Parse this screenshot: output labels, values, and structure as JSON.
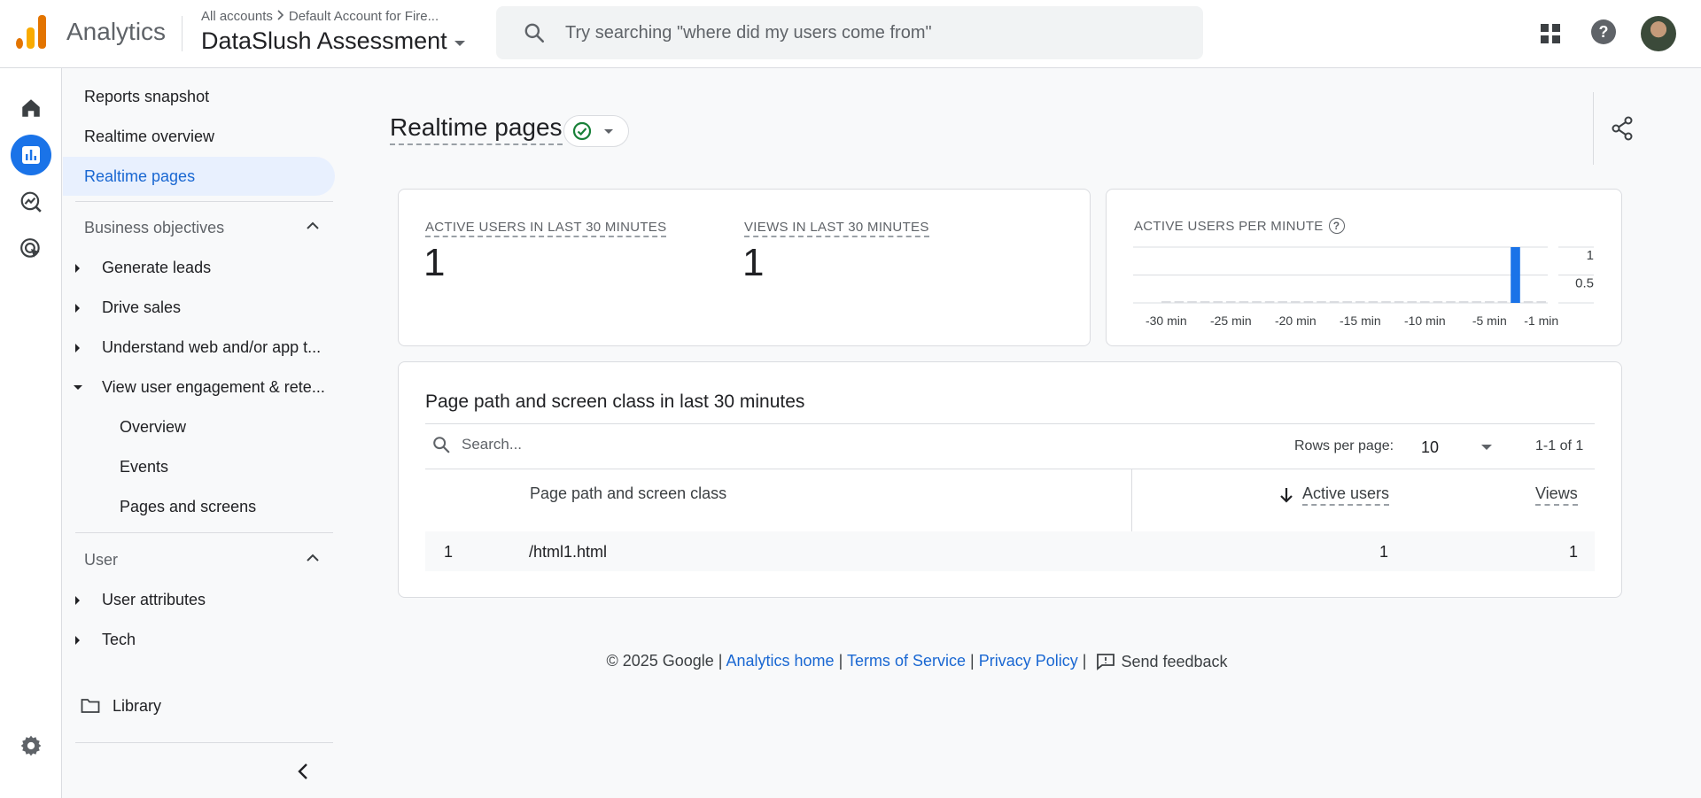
{
  "header": {
    "app_name": "Analytics",
    "breadcrumb_accounts": "All accounts",
    "breadcrumb_account": "Default Account for Fire...",
    "property_name": "DataSlush Assessment",
    "search_placeholder": "Try searching \"where did my users come from\""
  },
  "sidebar": {
    "items_top": [
      {
        "label": "Reports snapshot"
      },
      {
        "label": "Realtime overview"
      },
      {
        "label": "Realtime pages"
      }
    ],
    "business_objectives": {
      "title": "Business objectives",
      "items": [
        {
          "label": "Generate leads"
        },
        {
          "label": "Drive sales"
        },
        {
          "label": "Understand web and/or app t..."
        },
        {
          "label": "View user engagement & rete..."
        }
      ],
      "sub_items": [
        {
          "label": "Overview"
        },
        {
          "label": "Events"
        },
        {
          "label": "Pages and screens"
        }
      ]
    },
    "user_section": {
      "title": "User",
      "items": [
        {
          "label": "User attributes"
        },
        {
          "label": "Tech"
        }
      ]
    },
    "library_label": "Library"
  },
  "main": {
    "title": "Realtime pages",
    "metrics": {
      "active_users_label": "ACTIVE USERS IN LAST 30 MINUTES",
      "active_users_value": "1",
      "views_label": "VIEWS IN LAST 30 MINUTES",
      "views_value": "1"
    },
    "per_minute": {
      "label": "ACTIVE USERS PER MINUTE",
      "help": "?"
    },
    "table": {
      "title": "Page path and screen class in last 30 minutes",
      "search_placeholder": "Search...",
      "rows_per_page_label": "Rows per page:",
      "rows_per_page_value": "10",
      "pagination": "1-1 of 1",
      "columns": [
        "Page path and screen class",
        "Active users",
        "Views"
      ],
      "rows": [
        {
          "index": "1",
          "path": "/html1.html",
          "active_users": "1",
          "views": "1"
        }
      ]
    }
  },
  "footer": {
    "copyright": "© 2025 Google |",
    "analytics_home": "Analytics home",
    "sep1": "|",
    "terms": "Terms of Service",
    "sep2": "|",
    "privacy": "Privacy Policy",
    "sep3": "|",
    "feedback": "Send feedback"
  },
  "colors": {
    "accent": "#1a73e8",
    "link": "#1967d2",
    "active_nav_bg": "#e8f0fe",
    "bar": "#1a73e8",
    "logo_orange": "#e37400",
    "logo_yellow": "#f9ab00"
  },
  "chart_data": {
    "type": "bar",
    "title": "ACTIVE USERS PER MINUTE",
    "x_tick_labels": [
      "-30 min",
      "-25 min",
      "-20 min",
      "-15 min",
      "-10 min",
      "-5 min",
      "-1 min"
    ],
    "categories": [
      "-30",
      "-29",
      "-28",
      "-27",
      "-26",
      "-25",
      "-24",
      "-23",
      "-22",
      "-21",
      "-20",
      "-19",
      "-18",
      "-17",
      "-16",
      "-15",
      "-14",
      "-13",
      "-12",
      "-11",
      "-10",
      "-9",
      "-8",
      "-7",
      "-6",
      "-5",
      "-4",
      "-3",
      "-2",
      "-1"
    ],
    "values": [
      0,
      0,
      0,
      0,
      0,
      0,
      0,
      0,
      0,
      0,
      0,
      0,
      0,
      0,
      0,
      0,
      0,
      0,
      0,
      0,
      0,
      0,
      0,
      0,
      0,
      0,
      0,
      1,
      0,
      0
    ],
    "y_tick_labels": [
      "1",
      "0.5"
    ],
    "ylim": [
      0,
      1
    ],
    "grid": true,
    "legend": "none"
  }
}
